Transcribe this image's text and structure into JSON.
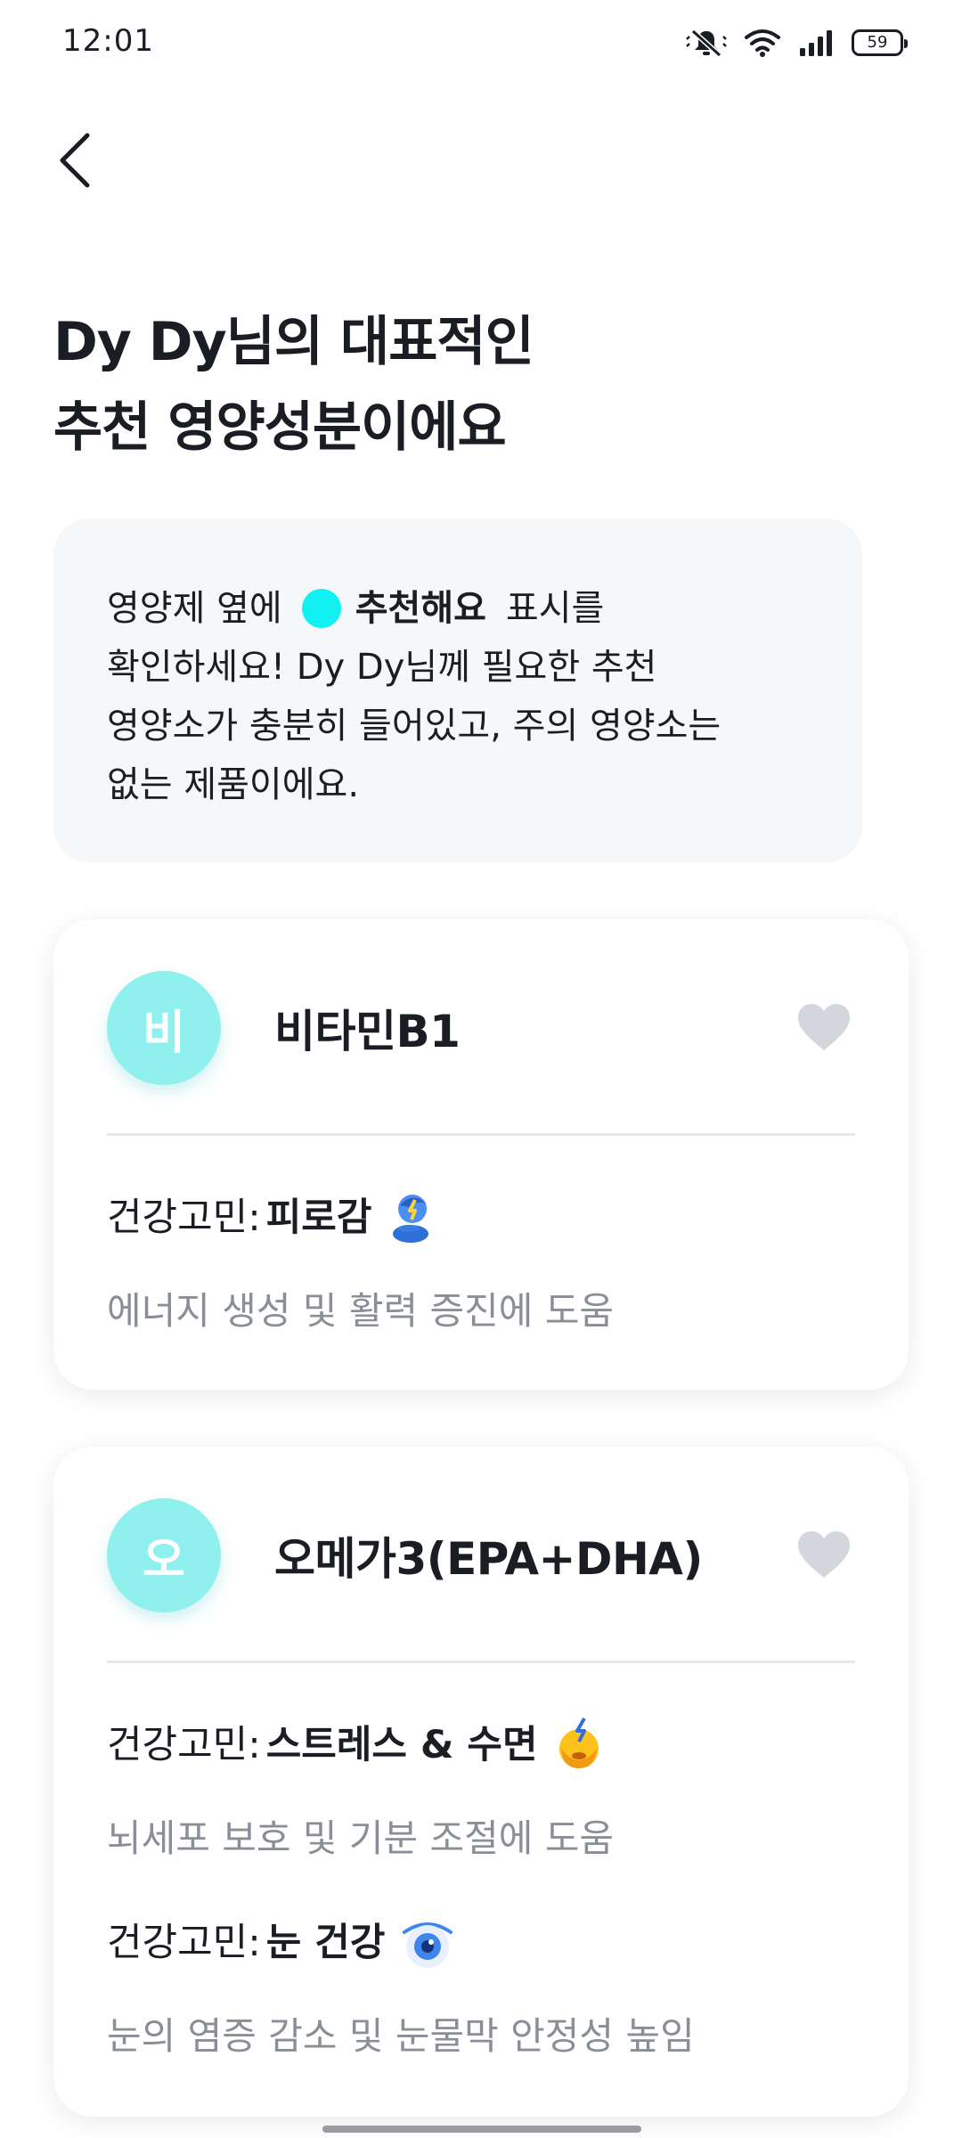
{
  "status_bar": {
    "time": "12:01",
    "battery_level": "59",
    "icons": [
      "mute-icon",
      "wifi-icon",
      "signal-icon",
      "battery-icon"
    ]
  },
  "header": {
    "back_icon": "chevron-left-icon"
  },
  "title": {
    "line1": "Dy Dy님의 대표적인",
    "line2": "추천 영양성분이에요"
  },
  "info": {
    "line1_before": "영양제 옆에",
    "badge_label": "추천해요",
    "line1_after": "표시를",
    "line2": "확인하세요! Dy Dy님께 필요한 추천",
    "line3": "영양소가 충분히 들어있고, 주의 영양소는",
    "line4": "없는 제품이에요.",
    "badge_color": "#12f0f2"
  },
  "nutrients": [
    {
      "avatar": "비",
      "name": "비타민B1",
      "favorite": false,
      "concerns": [
        {
          "prefix": "건강고민:",
          "value": "피로감",
          "icon": "tired-person-icon",
          "description": "에너지 생성 및 활력 증진에 도움"
        }
      ]
    },
    {
      "avatar": "오",
      "name": "오메가3(EPA+DHA)",
      "favorite": false,
      "concerns": [
        {
          "prefix": "건강고민:",
          "value": "스트레스 & 수면",
          "icon": "stressed-face-icon",
          "description": "뇌세포 보호 및 기분 조절에 도움"
        },
        {
          "prefix": "건강고민:",
          "value": "눈 건강",
          "icon": "eye-icon",
          "description": "눈의 염증 감소 및 눈물막 안정성 높임"
        }
      ]
    }
  ],
  "colors": {
    "accent_cyan": "#12f0f2",
    "avatar_bg": "#8ff0ee",
    "heart_inactive": "#d3d6dc",
    "muted_text": "#8a8e97"
  }
}
